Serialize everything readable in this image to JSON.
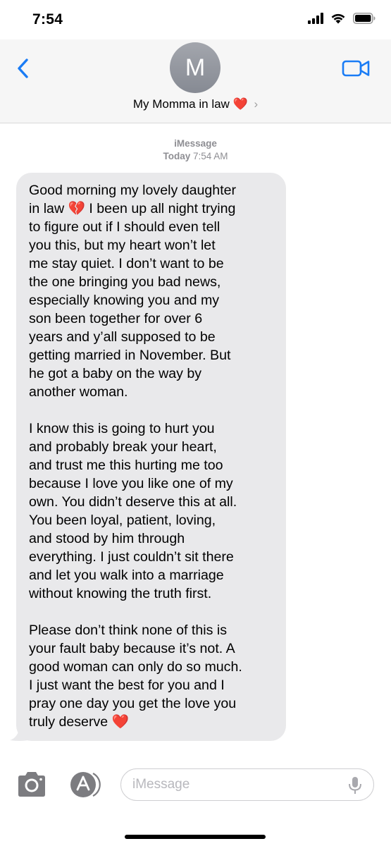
{
  "status_bar": {
    "time": "7:54"
  },
  "header": {
    "avatar_initial": "M",
    "contact_name": "My Momma in law",
    "contact_emoji": "❤️",
    "chevron": "›"
  },
  "thread_meta": {
    "service": "iMessage",
    "timestamp_day": "Today",
    "timestamp_time": "7:54 AM"
  },
  "message": {
    "paragraph_1_before_emoji": "Good morning my lovely daughter\nin law ",
    "paragraph_1_emoji": "💔",
    "paragraph_1_after_emoji": "  I been up all night trying\nto figure out if I should even tell\nyou this, but my heart won’t let\nme stay quiet. I don’t want to be\nthe one bringing you bad news,\nespecially knowing you and my\nson been together for over 6\nyears and y’all supposed to be\ngetting married in November. But\nhe got a baby on the way by\nanother woman.",
    "paragraph_2": "I know this is going to hurt you\nand probably break your heart,\nand trust me this hurting me too\nbecause I love you like one of my\nown. You didn’t deserve this at all.\nYou been loyal, patient, loving,\nand stood by him through\neverything. I just couldn’t sit there\nand let you walk into a marriage\nwithout knowing the truth first.",
    "paragraph_3_text": "Please don’t think none of this is\nyour fault baby because it’s not. A\ngood woman can only do so much.\nI just want the best for you and I\npray one day you get the love you\ntruly deserve ",
    "paragraph_3_emoji": "❤️"
  },
  "input_bar": {
    "placeholder": "iMessage"
  },
  "colors": {
    "accent": "#1a7cf5",
    "bubble": "#e9e9eb",
    "header_bg": "#f6f6f6",
    "meta_text": "#8e8e93",
    "icon_gray": "#7c7c80"
  },
  "icons": {
    "back": "chevron-left-icon",
    "video": "video-camera-icon",
    "camera": "camera-icon",
    "apps": "app-store-icon",
    "mic": "microphone-icon",
    "signal": "cellular-signal-icon",
    "wifi": "wifi-icon",
    "battery": "battery-icon"
  }
}
